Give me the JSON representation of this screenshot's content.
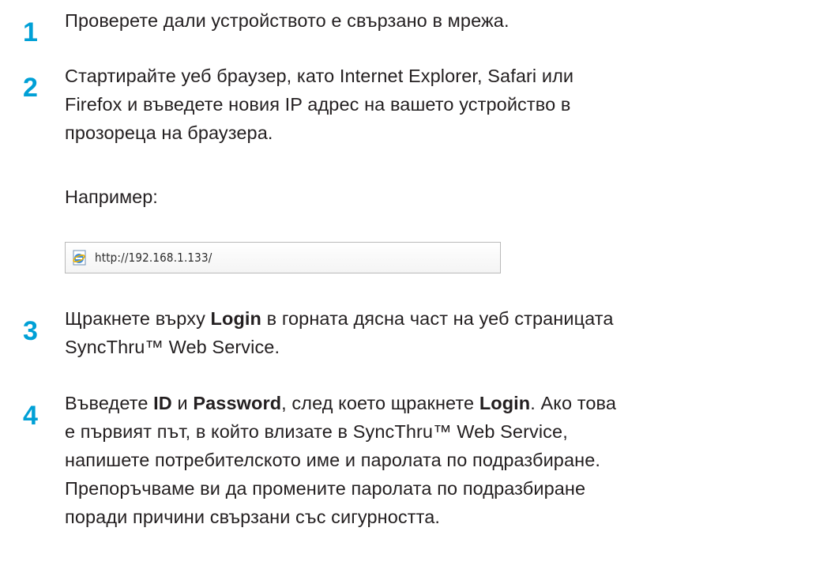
{
  "steps": [
    {
      "number": "1",
      "text": "Проверете дали устройството е свързано в мрежа."
    },
    {
      "number": "2",
      "lines": [
        "Стартирайте уеб браузер, като Internet Explorer, Safari или",
        "Firefox и въведете новия IP адрес на вашето устройство в",
        "прозореца на браузера."
      ],
      "example_label": "Например:",
      "url": "http://192.168.1.133/"
    },
    {
      "number": "3",
      "line1_before": "Щракнете върху ",
      "line1_bold": "Login",
      "line1_after": " в горната дясна част на уеб страницата",
      "line2": "SyncThru™ Web Service."
    },
    {
      "number": "4",
      "l1_a": "Въведете ",
      "l1_b": "ID",
      "l1_c": " и ",
      "l1_d": "Password",
      "l1_e": ", след което щракнете ",
      "l1_f": "Login",
      "l1_g": ". Ако това",
      "l2": "е първият път, в който влизате в SyncThru™ Web Service,",
      "l3": "напишете потребителското име и паролата по подразбиране.",
      "l4": "Препоръчваме ви да промените паролата по подразбиране",
      "l5": "поради причини свързани със сигурността."
    }
  ],
  "icons": {
    "browser_page_icon": "ie-page-icon"
  },
  "colors": {
    "step_number": "#00a0d6",
    "text": "#231f20"
  }
}
